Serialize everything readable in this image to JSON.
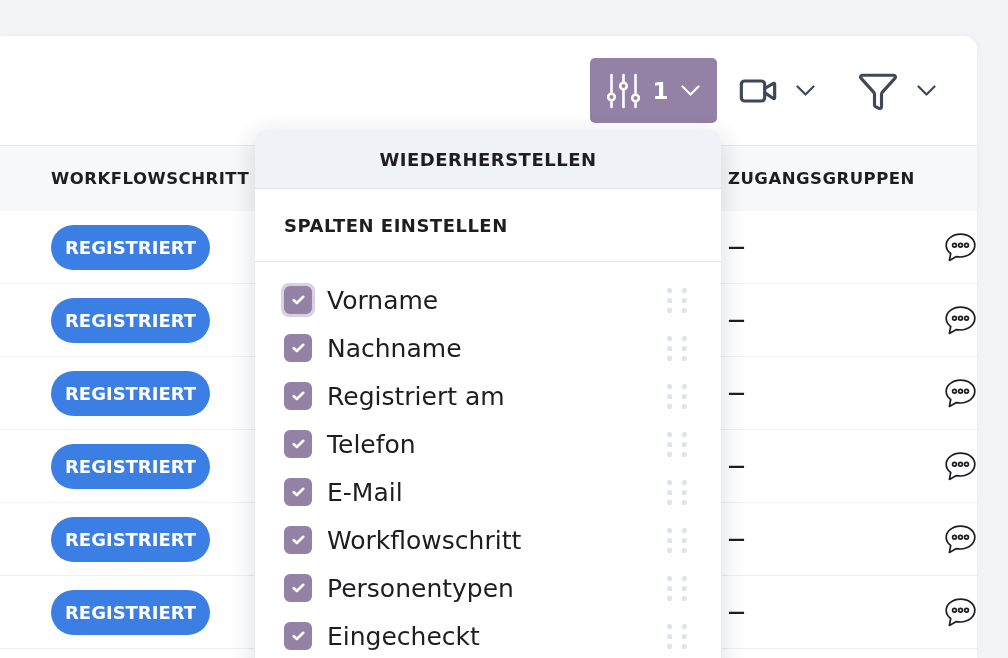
{
  "toolbar": {
    "columns_button": {
      "count": "1",
      "expanded": true
    }
  },
  "table": {
    "columns": [
      {
        "label": "WORKFLOWSCHRITT"
      },
      {
        "label": "ZUGANGSGRUPPEN"
      }
    ],
    "rows": [
      {
        "workflow_step": "REGISTRIERT",
        "access_groups": "—"
      },
      {
        "workflow_step": "REGISTRIERT",
        "access_groups": "—"
      },
      {
        "workflow_step": "REGISTRIERT",
        "access_groups": "—"
      },
      {
        "workflow_step": "REGISTRIERT",
        "access_groups": "—"
      },
      {
        "workflow_step": "REGISTRIERT",
        "access_groups": "—"
      },
      {
        "workflow_step": "REGISTRIERT",
        "access_groups": "—"
      }
    ]
  },
  "column_menu": {
    "reset_label": "WIEDERHERSTELLEN",
    "heading": "SPALTEN EINSTELLEN",
    "items": [
      {
        "label": "Vorname",
        "checked": true,
        "focused": true
      },
      {
        "label": "Nachname",
        "checked": true,
        "focused": false
      },
      {
        "label": "Registriert am",
        "checked": true,
        "focused": false
      },
      {
        "label": "Telefon",
        "checked": true,
        "focused": false
      },
      {
        "label": "E-Mail",
        "checked": true,
        "focused": false
      },
      {
        "label": "Workflowschritt",
        "checked": true,
        "focused": false
      },
      {
        "label": "Personentypen",
        "checked": true,
        "focused": false
      },
      {
        "label": "Eingecheckt",
        "checked": true,
        "focused": false
      }
    ]
  }
}
